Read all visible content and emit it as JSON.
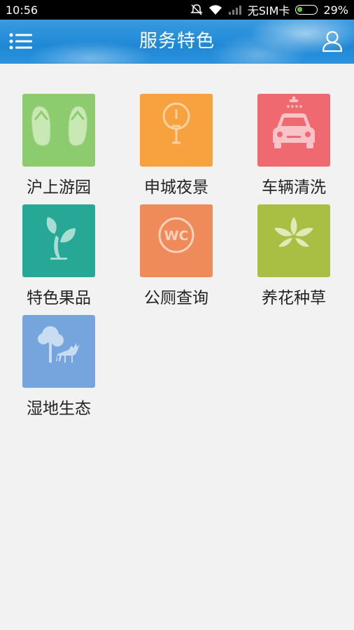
{
  "status_bar": {
    "time": "10:56",
    "carrier": "无SIM卡",
    "battery": "29%",
    "battery_level": 0.29
  },
  "header": {
    "title": "服务特色"
  },
  "tiles": [
    {
      "label": "沪上游园",
      "color": "#8ccb6e",
      "icon": "flip-flops-icon"
    },
    {
      "label": "申城夜景",
      "color": "#f7a23e",
      "icon": "street-lamp-icon"
    },
    {
      "label": "车辆清洗",
      "color": "#ef6a70",
      "icon": "car-wash-icon"
    },
    {
      "label": "特色果品",
      "color": "#27a897",
      "icon": "seedling-icon"
    },
    {
      "label": "公厕查询",
      "color": "#ef8a5a",
      "icon": "wc-icon"
    },
    {
      "label": "养花种草",
      "color": "#a9bf43",
      "icon": "flower-icon"
    },
    {
      "label": "湿地生态",
      "color": "#75a5dc",
      "icon": "tree-deer-icon"
    }
  ]
}
